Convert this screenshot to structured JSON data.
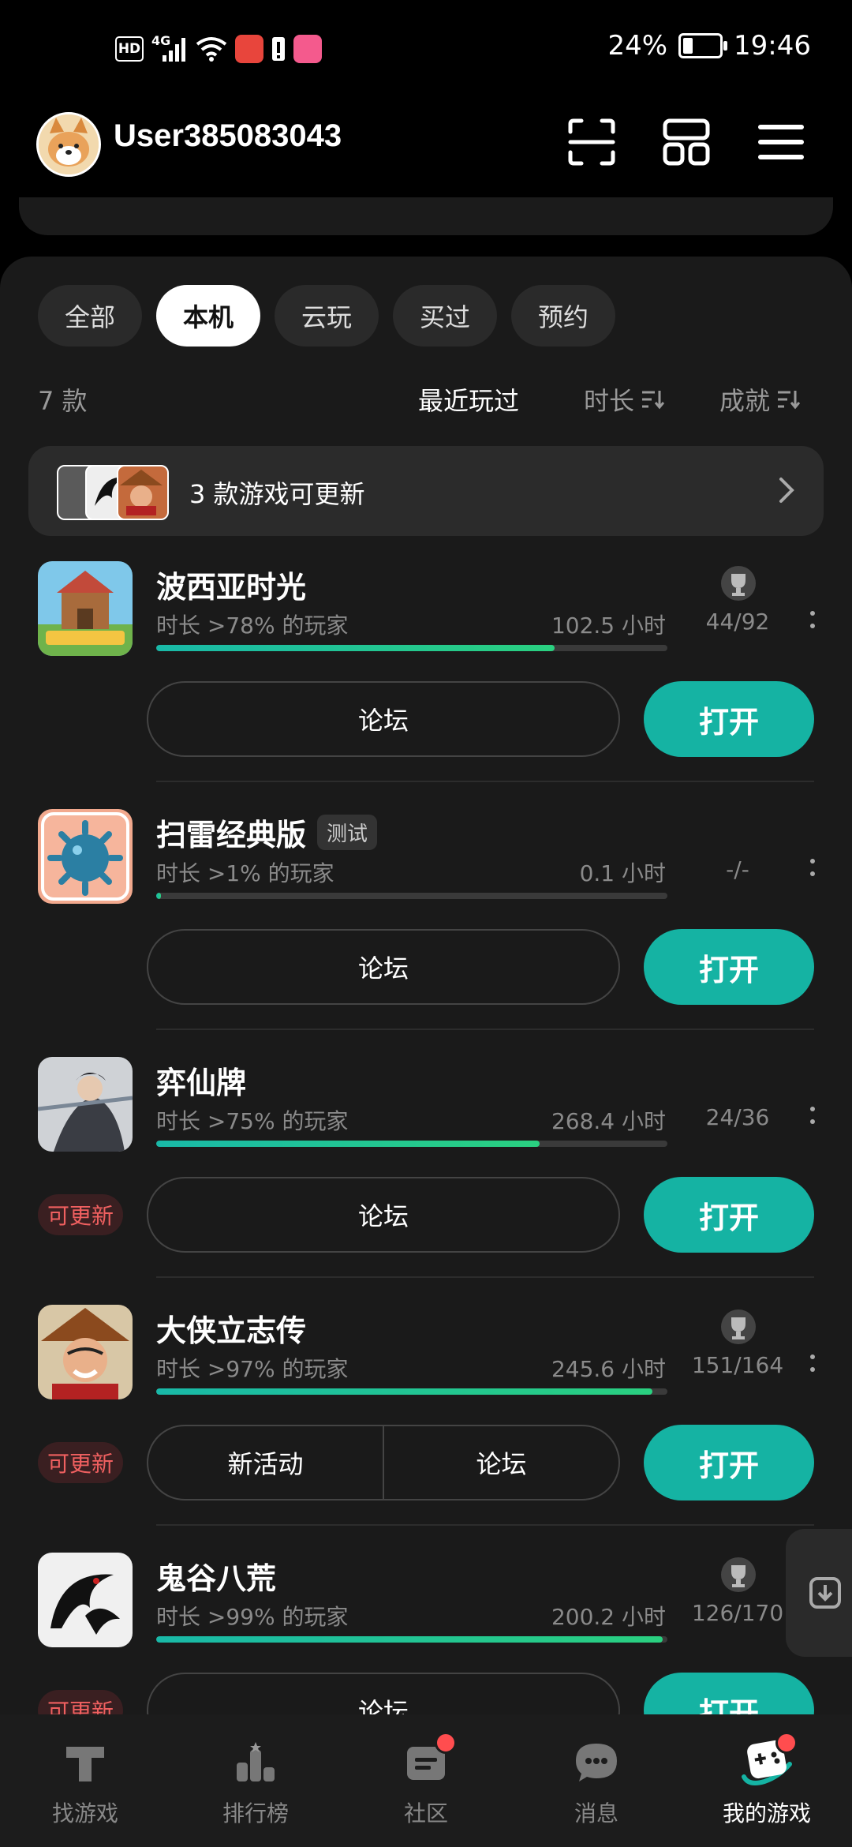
{
  "status_bar": {
    "hd": "HD",
    "network": "4G",
    "battery": "24%",
    "time": "19:46"
  },
  "header": {
    "username": "User385083043"
  },
  "tabs": [
    {
      "label": "全部",
      "active": false
    },
    {
      "label": "本机",
      "active": true
    },
    {
      "label": "云玩",
      "active": false
    },
    {
      "label": "买过",
      "active": false
    },
    {
      "label": "预约",
      "active": false
    }
  ],
  "sort_bar": {
    "count": "7 款",
    "recent": "最近玩过",
    "duration": "时长",
    "achievements": "成就"
  },
  "update_banner": {
    "text": "3 款游戏可更新"
  },
  "games": [
    {
      "name": "波西亚时光",
      "tag": "",
      "pct": "时长 >78% 的玩家",
      "hours": "102.5 小时",
      "progress": 0.78,
      "achievement": "44/92",
      "trophy": true,
      "update": "",
      "forum": "论坛",
      "activity": "",
      "open": "打开",
      "icon_name": "portia-game-icon"
    },
    {
      "name": "扫雷经典版",
      "tag": "测试",
      "pct": "时长 >1% 的玩家",
      "hours": "0.1 小时",
      "progress": 0.01,
      "achievement": "-/-",
      "trophy": false,
      "update": "",
      "forum": "论坛",
      "activity": "",
      "open": "打开",
      "icon_name": "minesweeper-game-icon"
    },
    {
      "name": "弈仙牌",
      "tag": "",
      "pct": "时长 >75% 的玩家",
      "hours": "268.4 小时",
      "progress": 0.75,
      "achievement": "24/36",
      "trophy": false,
      "update": "可更新",
      "forum": "论坛",
      "activity": "",
      "open": "打开",
      "icon_name": "yixianpai-game-icon"
    },
    {
      "name": "大侠立志传",
      "tag": "",
      "pct": "时长 >97% 的玩家",
      "hours": "245.6 小时",
      "progress": 0.97,
      "achievement": "151/164",
      "trophy": true,
      "update": "可更新",
      "forum": "论坛",
      "activity": "新活动",
      "open": "打开",
      "icon_name": "daxia-game-icon"
    },
    {
      "name": "鬼谷八荒",
      "tag": "",
      "pct": "时长 >99% 的玩家",
      "hours": "200.2 小时",
      "progress": 0.99,
      "achievement": "126/170",
      "trophy": true,
      "update": "可更新",
      "forum": "论坛",
      "activity": "",
      "open": "打开",
      "icon_name": "guigu-game-icon"
    }
  ],
  "bottom_nav": [
    {
      "label": "找游戏",
      "icon": "discover-icon",
      "active": false,
      "dot": false
    },
    {
      "label": "排行榜",
      "icon": "ranking-icon",
      "active": false,
      "dot": false
    },
    {
      "label": "社区",
      "icon": "community-icon",
      "active": false,
      "dot": true
    },
    {
      "label": "消息",
      "icon": "message-icon",
      "active": false,
      "dot": false
    },
    {
      "label": "我的游戏",
      "icon": "my-games-icon",
      "active": true,
      "dot": true
    }
  ],
  "colors": {
    "accent": "#15b3a3",
    "update_red": "#f06060",
    "panel": "#1a1a1a"
  }
}
